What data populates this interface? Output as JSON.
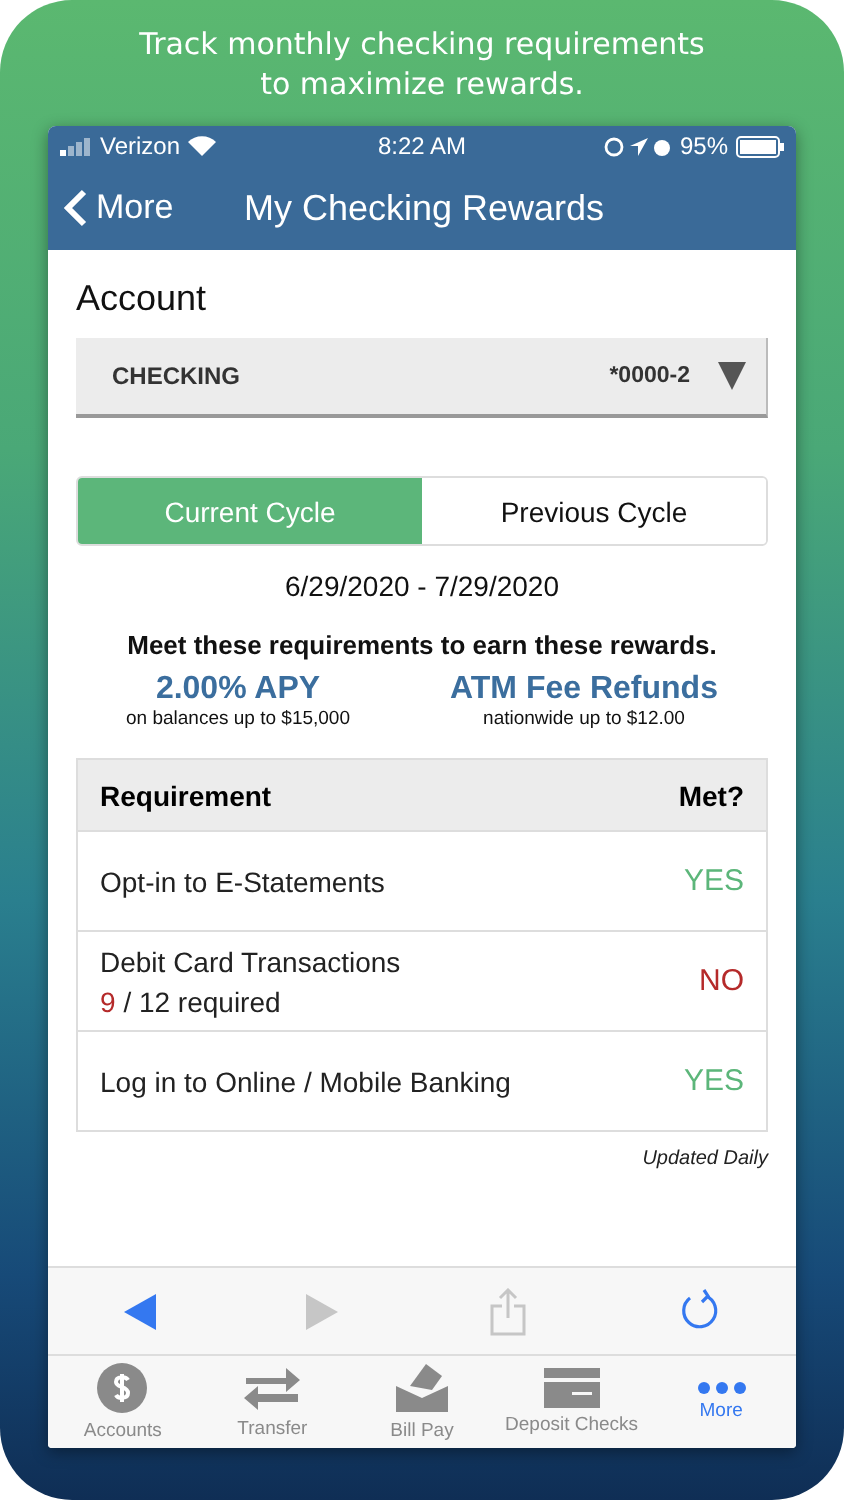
{
  "headline": "Track monthly checking requirements to maximize rewards.",
  "status_bar": {
    "carrier": "Verizon",
    "time": "8:22 AM",
    "battery": "95%"
  },
  "nav": {
    "back": "More",
    "title": "My Checking Rewards"
  },
  "account": {
    "label": "Account",
    "name": "CHECKING",
    "number": "*0000-2"
  },
  "cycle_tabs": [
    {
      "label": "Current Cycle",
      "selected": true
    },
    {
      "label": "Previous Cycle",
      "selected": false
    }
  ],
  "date_range": "6/29/2020 - 7/29/2020",
  "intro": "Meet these requirements to earn these rewards.",
  "rewards": [
    {
      "title": "2.00% APY",
      "detail": "on balances up to $15,000"
    },
    {
      "title": "ATM Fee Refunds",
      "detail": "nationwide up to $12.00"
    }
  ],
  "table": {
    "columns": [
      "Requirement",
      "Met?"
    ],
    "rows": [
      {
        "requirement": "Opt-in to E-Statements",
        "met": "YES",
        "passed": true
      },
      {
        "requirement": "Debit Card Transactions",
        "progress_count": "9",
        "progress_rest": "/ 12 required",
        "met": "NO",
        "passed": false
      },
      {
        "requirement": "Log in to Online / Mobile Banking",
        "met": "YES",
        "passed": true
      }
    ]
  },
  "footnote": "Updated Daily",
  "browser_toolbar": [
    {
      "kind": "back",
      "disabled": false
    },
    {
      "kind": "forward",
      "disabled": true
    },
    {
      "kind": "share",
      "disabled": true
    },
    {
      "kind": "refresh",
      "disabled": false
    }
  ],
  "tab_bar": [
    {
      "kind": "accounts",
      "label": "Accounts",
      "selected": false
    },
    {
      "kind": "transfer",
      "label": "Transfer",
      "selected": false
    },
    {
      "kind": "billpay",
      "label": "Bill Pay",
      "selected": false
    },
    {
      "kind": "deposit",
      "label": "Deposit Checks",
      "selected": false
    },
    {
      "kind": "more",
      "label": "More",
      "selected": true
    }
  ]
}
